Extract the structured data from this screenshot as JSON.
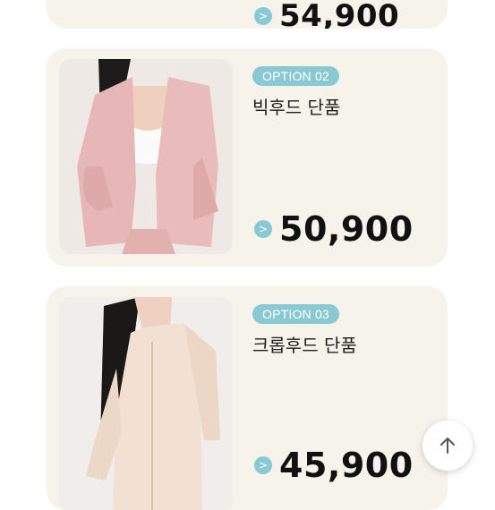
{
  "cards": [
    {
      "price": "54,900"
    },
    {
      "option": "OPTION 02",
      "name": "빅후드 단품",
      "price": "50,900"
    },
    {
      "option": "OPTION 03",
      "name": "크롭후드 단품",
      "price": "45,900"
    }
  ],
  "arrow_glyph": ">",
  "colors": {
    "card_bg": "#f6f3ea",
    "accent": "#88c9d3",
    "text": "#111111"
  },
  "icons": {
    "scroll_top": "arrow-up-icon"
  }
}
